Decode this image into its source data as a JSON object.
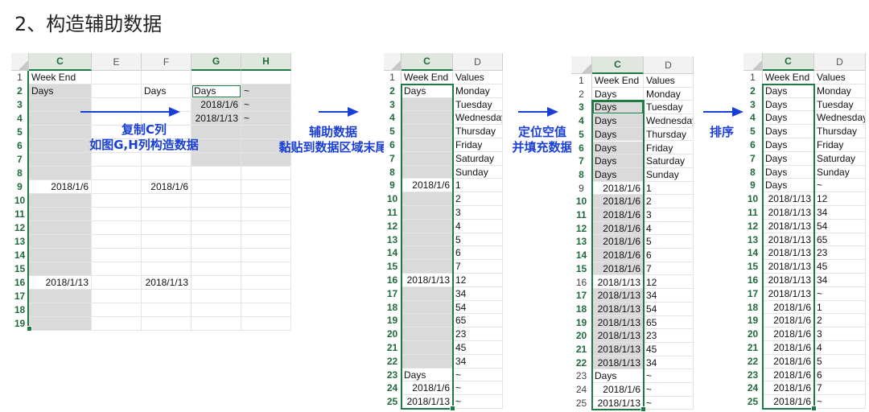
{
  "title": "2、构造辅助数据",
  "colors": {
    "accent": "#1f7a45",
    "annotation": "#1a3fd6",
    "grey_fill": "#dadada"
  },
  "sheet1": {
    "col_headers": [
      "C",
      "E",
      "F",
      "G",
      "H"
    ],
    "row_numbers": [
      "1",
      "2",
      "3",
      "4",
      "5",
      "6",
      "7",
      "8",
      "9",
      "10",
      "11",
      "12",
      "13",
      "14",
      "15",
      "16",
      "17",
      "18",
      "19"
    ],
    "c1": "Week End",
    "c2": "Days",
    "f2": "Days",
    "g2": "Days",
    "h2": "~",
    "g3": "2018/1/6",
    "h3": "~",
    "g4": "2018/1/13",
    "h4": "~",
    "c9": "2018/1/6",
    "f9": "2018/1/6",
    "c16": "2018/1/13",
    "f16": "2018/1/13"
  },
  "annotation1": {
    "line1": "复制C列",
    "line2": "如图G,H列构造数据"
  },
  "annotation2": {
    "line1": "辅助数据",
    "line2": "黏贴到数据区域末尾"
  },
  "annotation3": {
    "line1": "定位空值",
    "line2": "并填充数据"
  },
  "annotation4": {
    "line1": "排序"
  },
  "sheet2": {
    "col_headers": [
      "C",
      "D"
    ],
    "rows": [
      [
        "1",
        "Week End",
        "Values"
      ],
      [
        "2",
        "Days",
        "Monday"
      ],
      [
        "3",
        "",
        "Tuesday"
      ],
      [
        "4",
        "",
        "Wednesday"
      ],
      [
        "5",
        "",
        "Thursday"
      ],
      [
        "6",
        "",
        "Friday"
      ],
      [
        "7",
        "",
        "Saturday"
      ],
      [
        "8",
        "",
        "Sunday"
      ],
      [
        "9",
        "2018/1/6",
        "1"
      ],
      [
        "10",
        "",
        "2"
      ],
      [
        "11",
        "",
        "3"
      ],
      [
        "12",
        "",
        "4"
      ],
      [
        "13",
        "",
        "5"
      ],
      [
        "14",
        "",
        "6"
      ],
      [
        "15",
        "",
        "7"
      ],
      [
        "16",
        "2018/1/13",
        "12"
      ],
      [
        "17",
        "",
        "34"
      ],
      [
        "18",
        "",
        "54"
      ],
      [
        "19",
        "",
        "65"
      ],
      [
        "20",
        "",
        "23"
      ],
      [
        "21",
        "",
        "45"
      ],
      [
        "22",
        "",
        "34"
      ],
      [
        "23",
        "Days",
        "~"
      ],
      [
        "24",
        "2018/1/6",
        "~"
      ],
      [
        "25",
        "2018/1/13",
        "~"
      ]
    ]
  },
  "sheet3": {
    "col_headers": [
      "C",
      "D"
    ],
    "rows": [
      [
        "1",
        "Week End",
        "Values"
      ],
      [
        "2",
        "Days",
        "Monday"
      ],
      [
        "3",
        "Days",
        "Tuesday"
      ],
      [
        "4",
        "Days",
        "Wednesday"
      ],
      [
        "5",
        "Days",
        "Thursday"
      ],
      [
        "6",
        "Days",
        "Friday"
      ],
      [
        "7",
        "Days",
        "Saturday"
      ],
      [
        "8",
        "Days",
        "Sunday"
      ],
      [
        "9",
        "2018/1/6",
        "1"
      ],
      [
        "10",
        "2018/1/6",
        "2"
      ],
      [
        "11",
        "2018/1/6",
        "3"
      ],
      [
        "12",
        "2018/1/6",
        "4"
      ],
      [
        "13",
        "2018/1/6",
        "5"
      ],
      [
        "14",
        "2018/1/6",
        "6"
      ],
      [
        "15",
        "2018/1/6",
        "7"
      ],
      [
        "16",
        "2018/1/13",
        "12"
      ],
      [
        "17",
        "2018/1/13",
        "34"
      ],
      [
        "18",
        "2018/1/13",
        "54"
      ],
      [
        "19",
        "2018/1/13",
        "65"
      ],
      [
        "20",
        "2018/1/13",
        "23"
      ],
      [
        "21",
        "2018/1/13",
        "45"
      ],
      [
        "22",
        "2018/1/13",
        "34"
      ],
      [
        "23",
        "Days",
        "~"
      ],
      [
        "24",
        "2018/1/6",
        "~"
      ],
      [
        "25",
        "2018/1/13",
        "~"
      ]
    ]
  },
  "sheet4": {
    "col_headers": [
      "C",
      "D"
    ],
    "rows": [
      [
        "1",
        "Week End",
        "Values"
      ],
      [
        "2",
        "Days",
        "Monday"
      ],
      [
        "3",
        "Days",
        "Tuesday"
      ],
      [
        "4",
        "Days",
        "Wednesday"
      ],
      [
        "5",
        "Days",
        "Thursday"
      ],
      [
        "6",
        "Days",
        "Friday"
      ],
      [
        "7",
        "Days",
        "Saturday"
      ],
      [
        "8",
        "Days",
        "Sunday"
      ],
      [
        "9",
        "Days",
        "~"
      ],
      [
        "10",
        "2018/1/13",
        "12"
      ],
      [
        "11",
        "2018/1/13",
        "34"
      ],
      [
        "12",
        "2018/1/13",
        "54"
      ],
      [
        "13",
        "2018/1/13",
        "65"
      ],
      [
        "14",
        "2018/1/13",
        "23"
      ],
      [
        "15",
        "2018/1/13",
        "45"
      ],
      [
        "16",
        "2018/1/13",
        "34"
      ],
      [
        "17",
        "2018/1/13",
        "~"
      ],
      [
        "18",
        "2018/1/6",
        "1"
      ],
      [
        "19",
        "2018/1/6",
        "2"
      ],
      [
        "20",
        "2018/1/6",
        "3"
      ],
      [
        "21",
        "2018/1/6",
        "4"
      ],
      [
        "22",
        "2018/1/6",
        "5"
      ],
      [
        "23",
        "2018/1/6",
        "6"
      ],
      [
        "24",
        "2018/1/6",
        "7"
      ],
      [
        "25",
        "2018/1/6",
        "~"
      ]
    ]
  }
}
